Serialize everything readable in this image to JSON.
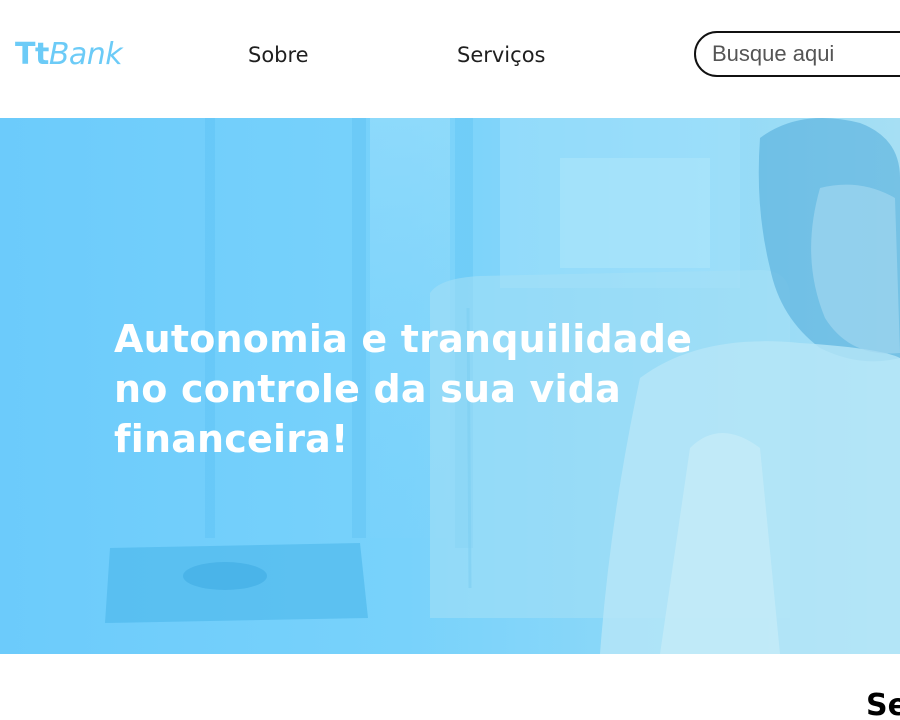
{
  "header": {
    "logo_primary": "Tt",
    "logo_secondary": "Bank",
    "nav": {
      "sobre": "Sobre",
      "servicos": "Serviços"
    },
    "search": {
      "placeholder": "Busque aqui",
      "icon": "none"
    }
  },
  "hero": {
    "title": "Autonomia e tranquilidade no controle da sua vida financeira!",
    "overlay_color": "#6ccbfb",
    "image": "woman-at-home-photo"
  },
  "section": {
    "heading_visible": "Se"
  },
  "colors": {
    "brand": "#6ccbf7",
    "text": "#1f1f1f"
  }
}
